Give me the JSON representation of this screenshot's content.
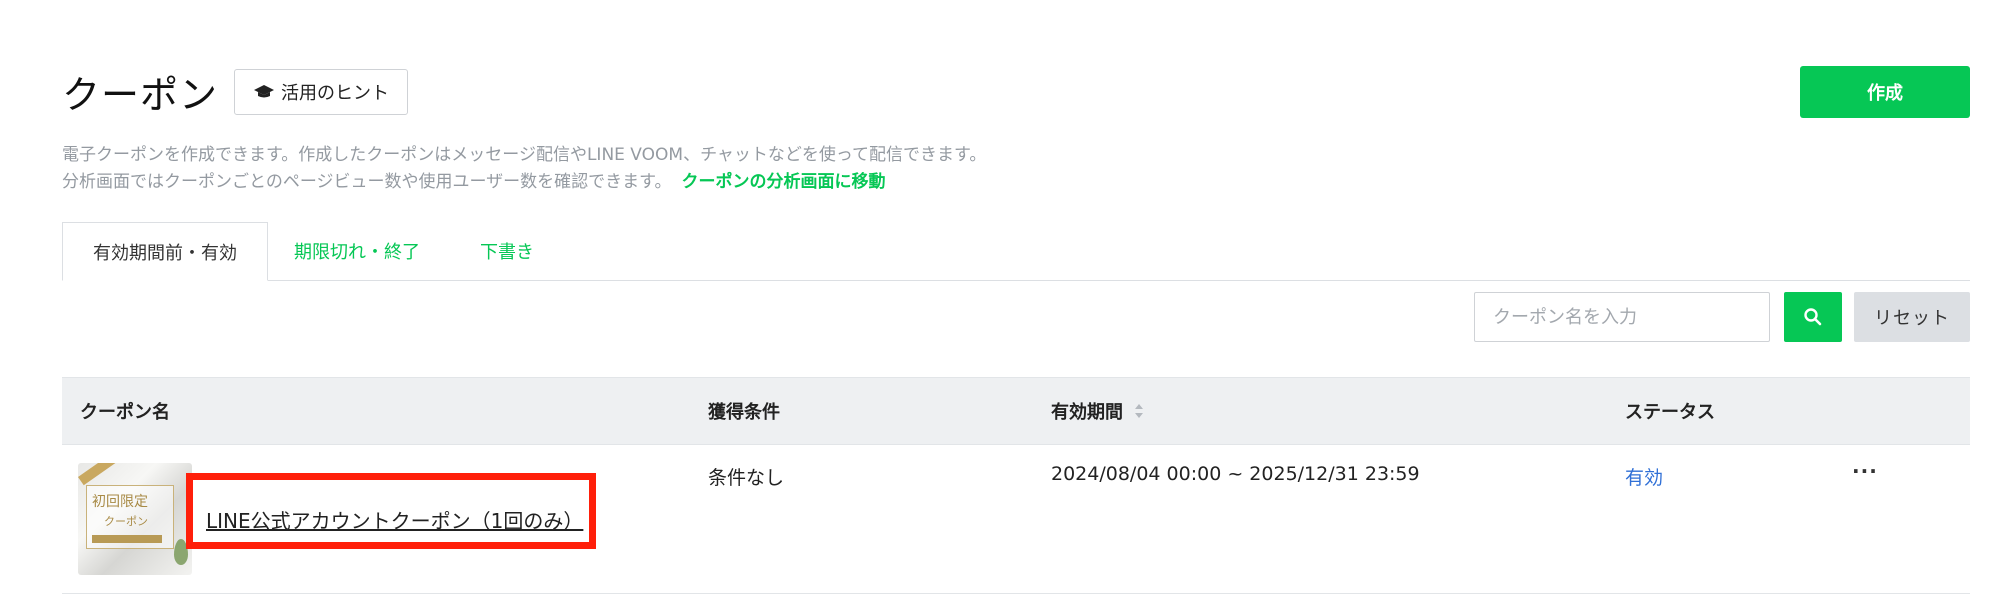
{
  "header": {
    "title": "クーポン",
    "hint_label": "活用のヒント",
    "create_label": "作成"
  },
  "description": {
    "line1": "電子クーポンを作成できます。作成したクーポンはメッセージ配信やLINE VOOM、チャットなどを使って配信できます。",
    "line2": "分析画面ではクーポンごとのページビュー数や使用ユーザー数を確認できます。",
    "link": "クーポンの分析画面に移動"
  },
  "tabs": [
    {
      "label": "有効期間前・有効",
      "active": true
    },
    {
      "label": "期限切れ・終了",
      "active": false
    },
    {
      "label": "下書き",
      "active": false
    }
  ],
  "search": {
    "placeholder": "クーポン名を入力",
    "reset_label": "リセット"
  },
  "table": {
    "headers": [
      "クーポン名",
      "獲得条件",
      "有効期間",
      "ステータス"
    ],
    "rows": [
      {
        "name": "LINE公式アカウントクーポン（1回のみ）",
        "condition": "条件なし",
        "period": "2024/08/04 00:00 ~ 2025/12/31 23:59",
        "status": "有効",
        "more": "···",
        "thumbnail": {
          "line1": "初回限定",
          "line2": "クーポン"
        }
      }
    ]
  },
  "colors": {
    "accent": "#06c755",
    "status_active": "#2f6fd6",
    "highlight": "#ff1f0a"
  },
  "icons": {
    "hint": "graduation-cap-icon",
    "search": "search-icon",
    "sort": "sort-icon",
    "more": "more-horizontal-icon"
  }
}
